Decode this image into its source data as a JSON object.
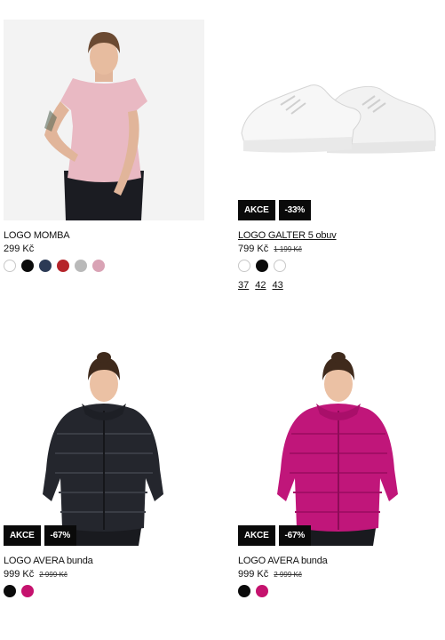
{
  "products": [
    {
      "name": "LOGO MOMBA",
      "price": "299 Kč",
      "colors": [
        "#ffffff",
        "#0b0b0b",
        "#2c3a55",
        "#b5242a",
        "#b9b9b9",
        "#d9a3b5"
      ],
      "image": "woman-in-pink-t-shirt"
    },
    {
      "name": "LOGO GALTER 5 obuv",
      "price": "799 Kč",
      "old_price": "1 199 Kč",
      "badge_label": "AKCE",
      "discount": "-33%",
      "colors": [
        "#ffffff",
        "#0b0b0b",
        "#ffffff"
      ],
      "sizes": [
        "37",
        "42",
        "43"
      ],
      "image": "white-sneakers"
    },
    {
      "name": "LOGO AVERA bunda",
      "price": "999 Kč",
      "old_price": "2 999 Kč",
      "badge_label": "AKCE",
      "discount": "-67%",
      "colors": [
        "#0b0b0b",
        "#c5126e"
      ],
      "image": "woman-in-black-puffer-jacket"
    },
    {
      "name": "LOGO AVERA bunda",
      "price": "999 Kč",
      "old_price": "2 999 Kč",
      "badge_label": "AKCE",
      "discount": "-67%",
      "colors": [
        "#0b0b0b",
        "#c5126e"
      ],
      "image": "woman-in-magenta-puffer-jacket"
    }
  ],
  "icons": {
    "wishlist": "heart-icon"
  }
}
